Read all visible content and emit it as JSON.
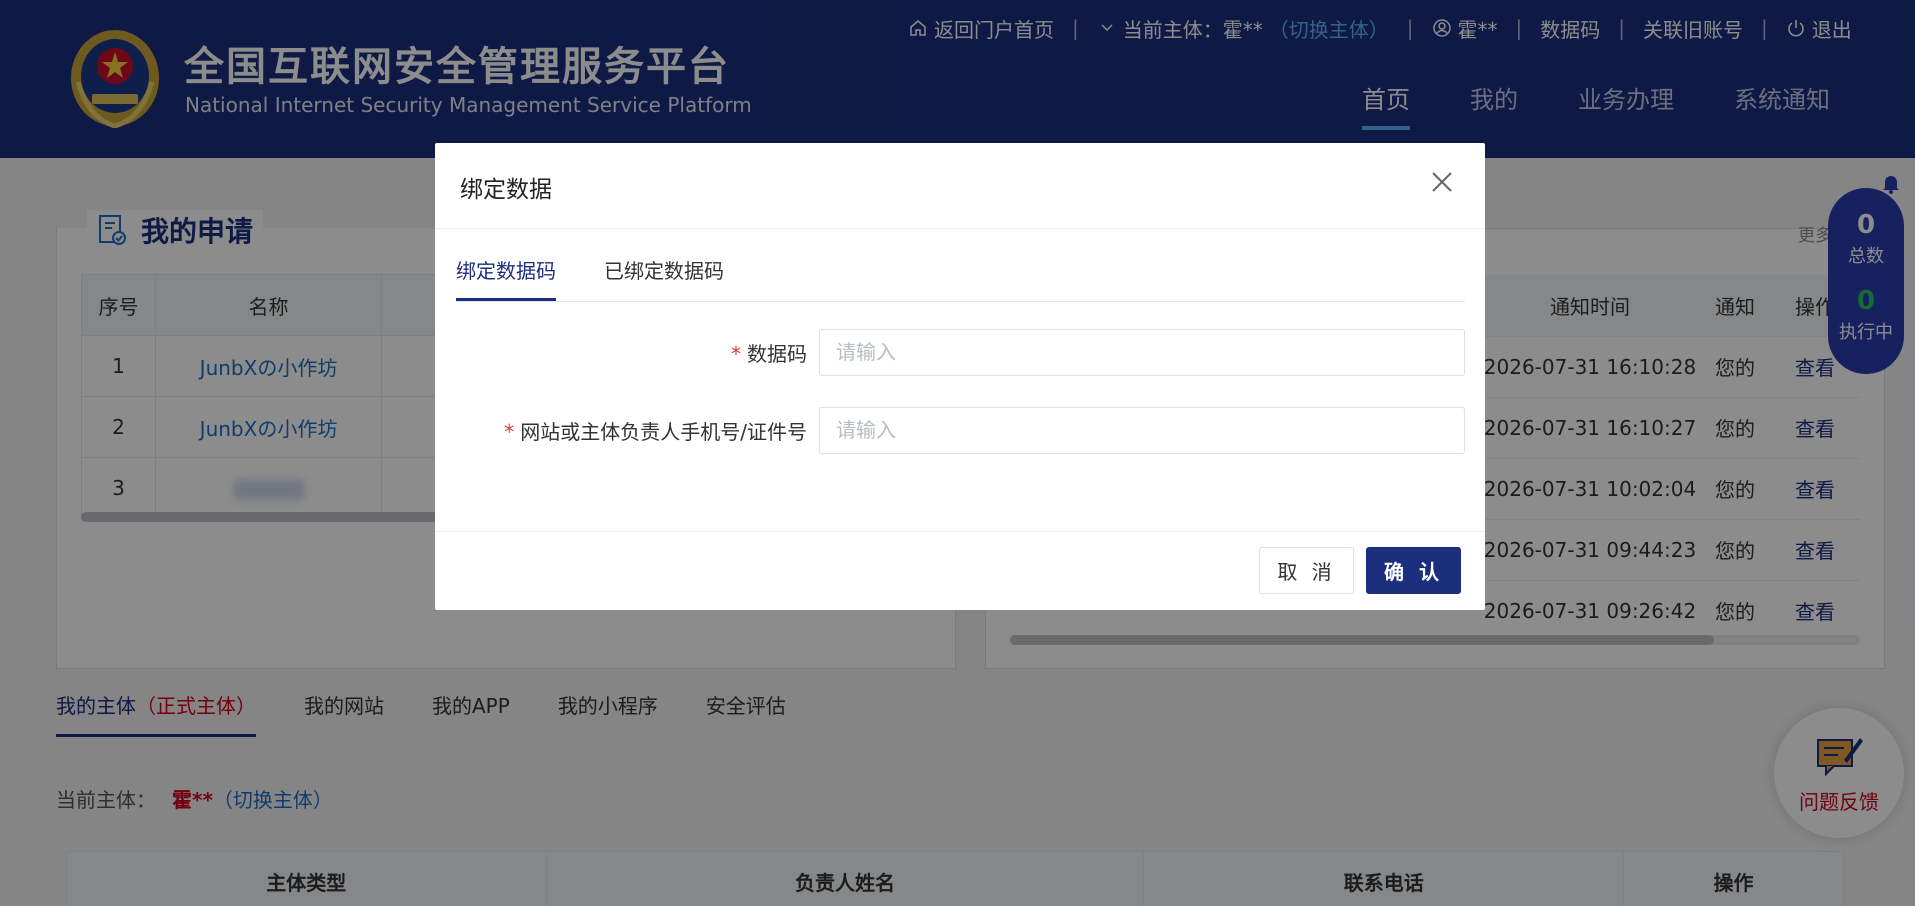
{
  "header": {
    "title": "全国互联网安全管理服务平台",
    "subtitle": "National Internet Security Management Service Platform",
    "topbar": {
      "home": "返回门户首页",
      "current_subject_label": "当前主体：霍**",
      "switch_subject": "（切换主体）",
      "user": "霍**",
      "data_code": "数据码",
      "link_old_account": "关联旧账号",
      "logout": "退出"
    },
    "nav": [
      "首页",
      "我的",
      "业务办理",
      "系统通知"
    ]
  },
  "applications": {
    "title": "我的申请",
    "columns": [
      "序号",
      "名称"
    ],
    "rows": [
      {
        "no": "1",
        "name": "JunbXの小作坊"
      },
      {
        "no": "2",
        "name": "JunbXの小作坊"
      },
      {
        "no": "3",
        "name": ""
      }
    ]
  },
  "notifications": {
    "more": "更多",
    "columns": [
      "通知时间",
      "通知",
      "操作"
    ],
    "rows": [
      {
        "time": "2026-07-31 16:10:28",
        "content": "您的",
        "action": "查看"
      },
      {
        "time": "2026-07-31 16:10:27",
        "content": "您的",
        "action": "查看"
      },
      {
        "time": "2026-07-31 10:02:04",
        "content": "您的",
        "action": "查看"
      },
      {
        "time": "2026-07-31 09:44:23",
        "content": "您的",
        "action": "查看"
      },
      {
        "time": "2026-07-31 09:26:42",
        "content": "您的",
        "action": "查看"
      }
    ]
  },
  "counter": {
    "total_num": "0",
    "total_label": "总数",
    "running_num": "0",
    "running_label": "执行中"
  },
  "feedback": {
    "label": "问题反馈"
  },
  "bottom": {
    "tabs": {
      "subject": "我的主体",
      "subject_formal": "（正式主体）",
      "website": "我的网站",
      "app": "我的APP",
      "mini": "我的小程序",
      "assess": "安全评估"
    },
    "current_subject": "当前主体：",
    "subject_name": "霍**",
    "switch": "（切换主体）",
    "columns": [
      "主体类型",
      "负责人姓名",
      "联系电话",
      "操作"
    ]
  },
  "modal": {
    "title": "绑定数据",
    "tabs": [
      "绑定数据码",
      "已绑定数据码"
    ],
    "fields": [
      {
        "label": "数据码",
        "placeholder": "请输入",
        "value": ""
      },
      {
        "label": "网站或主体负责人手机号/证件号",
        "placeholder": "请输入",
        "value": ""
      }
    ],
    "cancel": "取 消",
    "confirm": "确 认"
  },
  "colors": {
    "primary": "#1b2f7e",
    "link": "#1d6ec8",
    "required": "#e53935",
    "highlight": "#d0021b"
  }
}
